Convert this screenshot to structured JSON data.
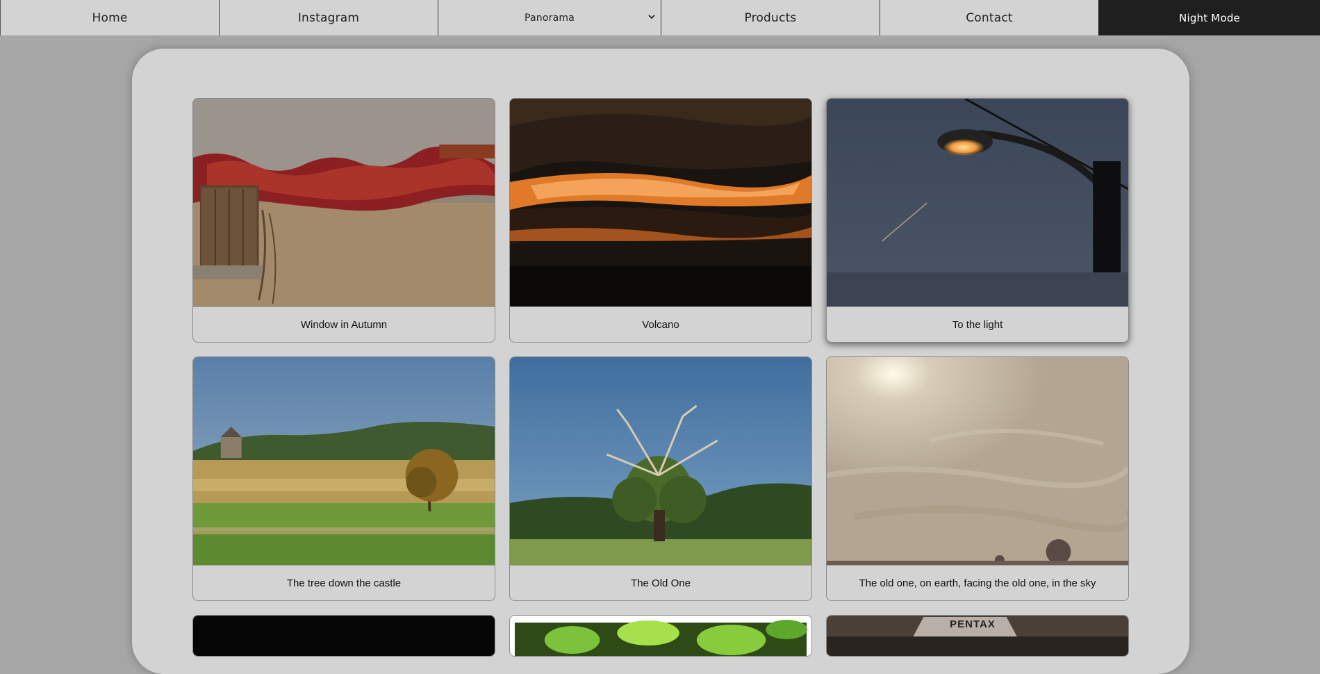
{
  "nav": {
    "home": "Home",
    "instagram": "Instagram",
    "panorama": "Panorama",
    "products": "Products",
    "contact": "Contact",
    "night_mode": "Night Mode"
  },
  "gallery": {
    "cards": [
      {
        "caption": "Window in Autumn"
      },
      {
        "caption": "Volcano"
      },
      {
        "caption": "To the light"
      },
      {
        "caption": "The tree down the castle"
      },
      {
        "caption": "The Old One"
      },
      {
        "caption": "The old one, on earth, facing the old one, in the sky"
      }
    ],
    "partial_text": "PENTAX"
  },
  "colors": {
    "page_bg": "#a6a6a6",
    "panel_bg": "#d3d3d3",
    "night_bg": "#1f1f1f"
  }
}
